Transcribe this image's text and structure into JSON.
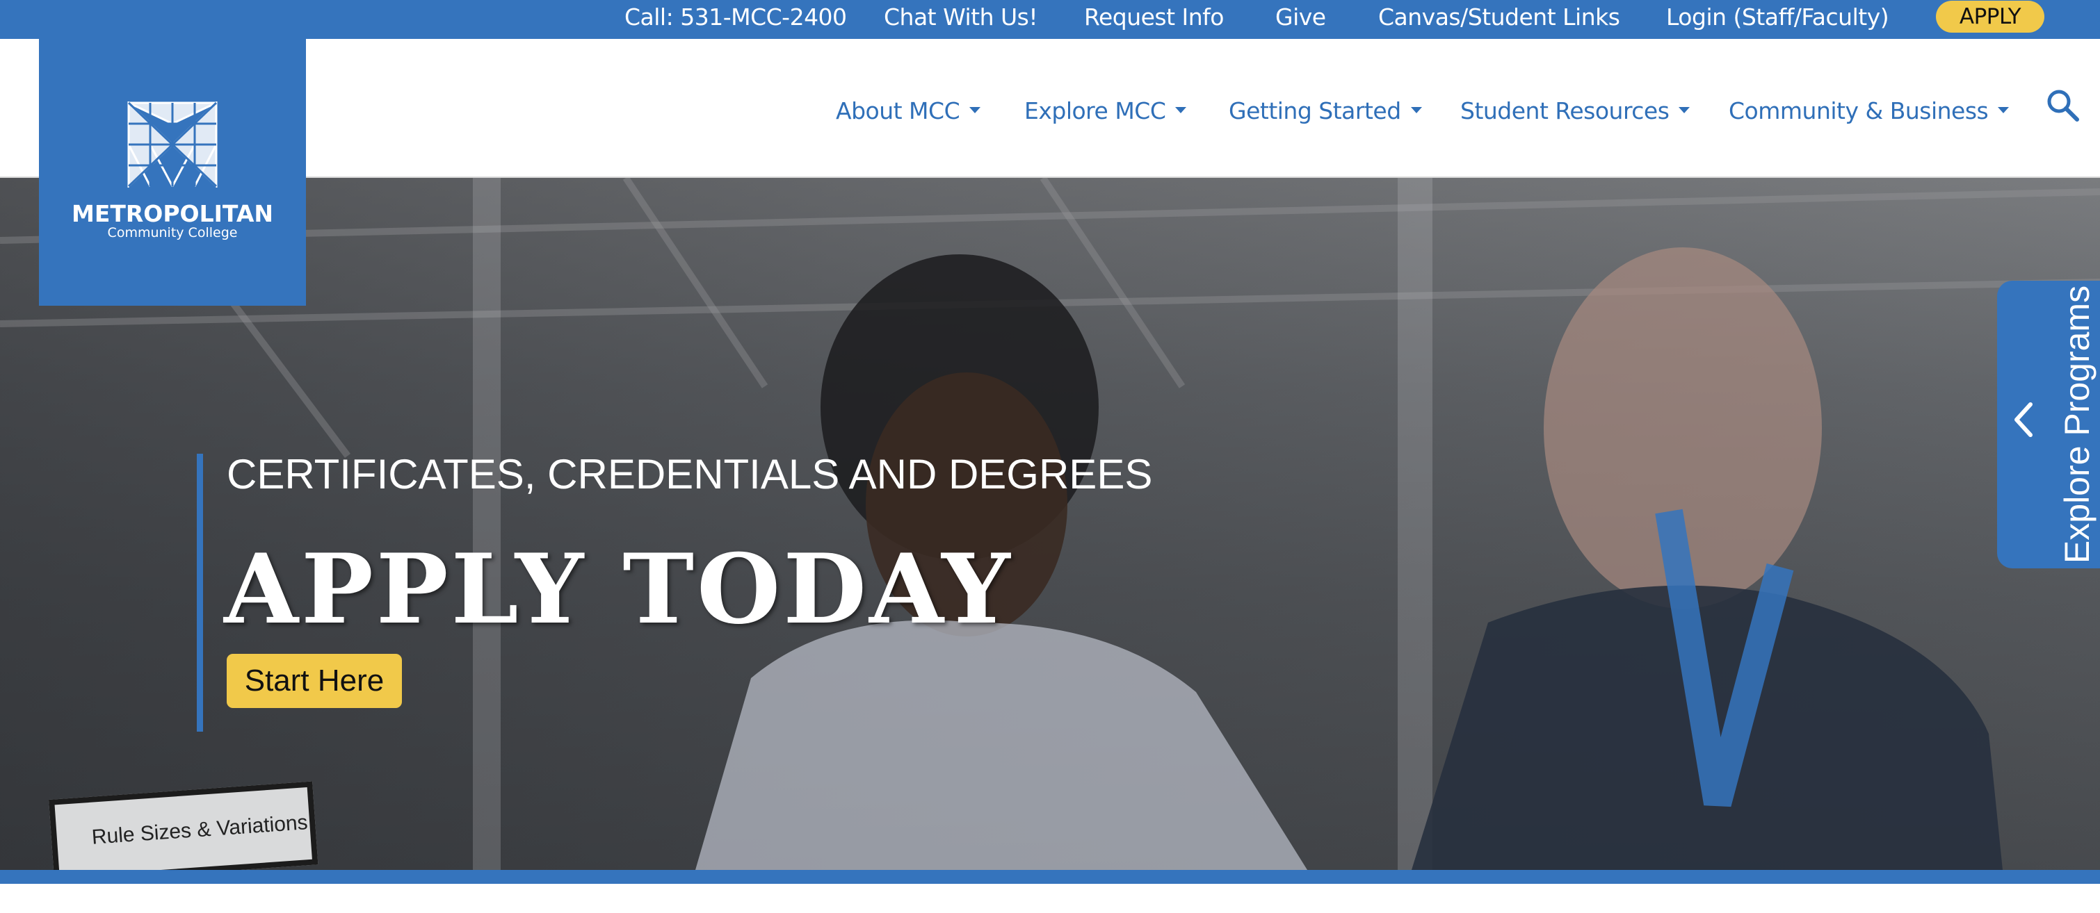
{
  "topbar": {
    "call": "Call: 531-MCC-2400",
    "chat": "Chat With Us!",
    "request_info": "Request Info",
    "give": "Give",
    "canvas": "Canvas/Student Links",
    "login": "Login (Staff/Faculty)",
    "apply": "APPLY"
  },
  "logo": {
    "name": "METROPOLITAN",
    "subtitle": "Community College"
  },
  "nav": {
    "items": [
      {
        "label": "About MCC"
      },
      {
        "label": "Explore MCC"
      },
      {
        "label": "Getting Started"
      },
      {
        "label": "Student Resources"
      },
      {
        "label": "Community & Business"
      }
    ],
    "search_icon": "search-icon"
  },
  "hero": {
    "kicker": "CERTIFICATES, CREDENTIALS AND DEGREES",
    "headline": "APPLY TODAY",
    "cta": "Start Here",
    "sign_text": "Rule Sizes & Variations"
  },
  "side_tab": {
    "label": "Explore Programs",
    "icon": "chevron-left-icon"
  },
  "colors": {
    "brand_blue": "#3574bd",
    "accent_yellow": "#f1c94a",
    "nav_text": "#2f6fb8"
  }
}
